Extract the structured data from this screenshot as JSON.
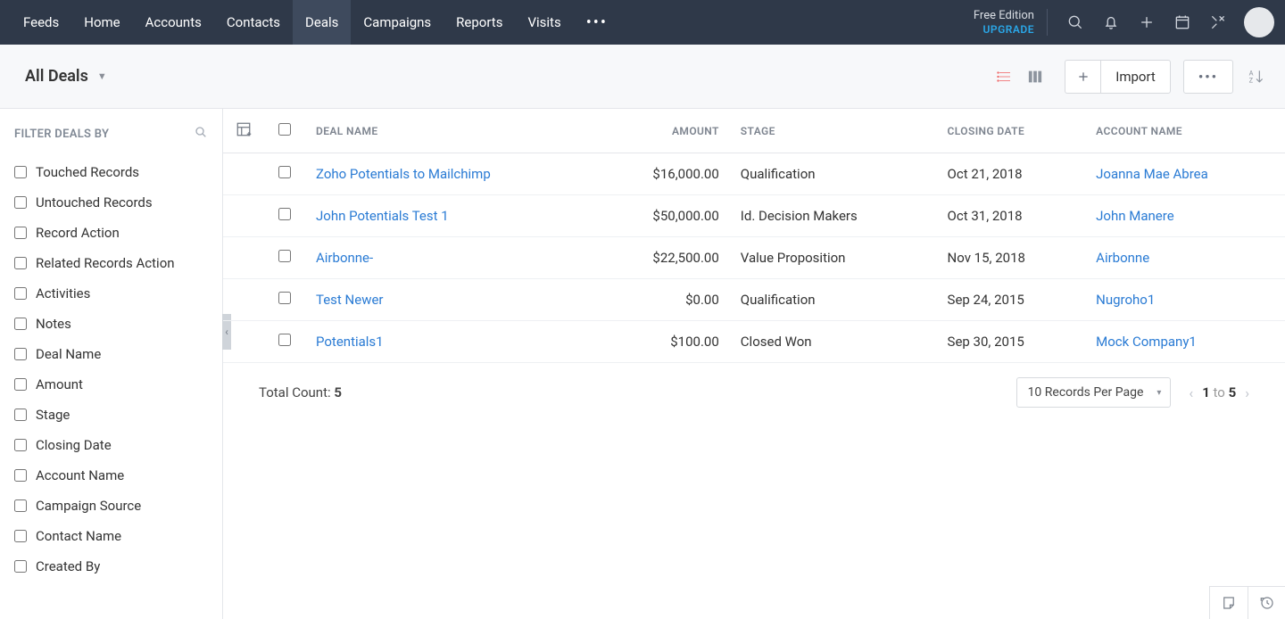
{
  "nav": {
    "items": [
      "Feeds",
      "Home",
      "Accounts",
      "Contacts",
      "Deals",
      "Campaigns",
      "Reports",
      "Visits"
    ],
    "activeIndex": 4
  },
  "edition": {
    "label": "Free Edition",
    "upgrade": "UPGRADE"
  },
  "view": {
    "name": "All Deals"
  },
  "toolbar": {
    "import_label": "Import"
  },
  "sidebar": {
    "title": "FILTER DEALS BY",
    "filters": [
      "Touched Records",
      "Untouched Records",
      "Record Action",
      "Related Records Action",
      "Activities",
      "Notes",
      "Deal Name",
      "Amount",
      "Stage",
      "Closing Date",
      "Account Name",
      "Campaign Source",
      "Contact Name",
      "Created By"
    ]
  },
  "table": {
    "columns": [
      "DEAL NAME",
      "AMOUNT",
      "STAGE",
      "CLOSING DATE",
      "ACCOUNT NAME"
    ],
    "rows": [
      {
        "deal": "Zoho Potentials to Mailchimp",
        "amount": "$16,000.00",
        "stage": "Qualification",
        "closing": "Oct 21, 2018",
        "account": "Joanna Mae Abrea"
      },
      {
        "deal": "John Potentials Test 1",
        "amount": "$50,000.00",
        "stage": "Id. Decision Makers",
        "closing": "Oct 31, 2018",
        "account": "John Manere"
      },
      {
        "deal": "Airbonne-",
        "amount": "$22,500.00",
        "stage": "Value Proposition",
        "closing": "Nov 15, 2018",
        "account": "Airbonne"
      },
      {
        "deal": "Test Newer",
        "amount": "$0.00",
        "stage": "Qualification",
        "closing": "Sep 24, 2015",
        "account": "Nugroho1"
      },
      {
        "deal": "Potentials1",
        "amount": "$100.00",
        "stage": "Closed Won",
        "closing": "Sep 30, 2015",
        "account": "Mock Company1"
      }
    ]
  },
  "footer": {
    "total_label": "Total Count: ",
    "total_count": "5",
    "per_page_label": "10 Records Per Page",
    "pager_from": "1",
    "pager_to_word": " to ",
    "pager_to": "5"
  }
}
